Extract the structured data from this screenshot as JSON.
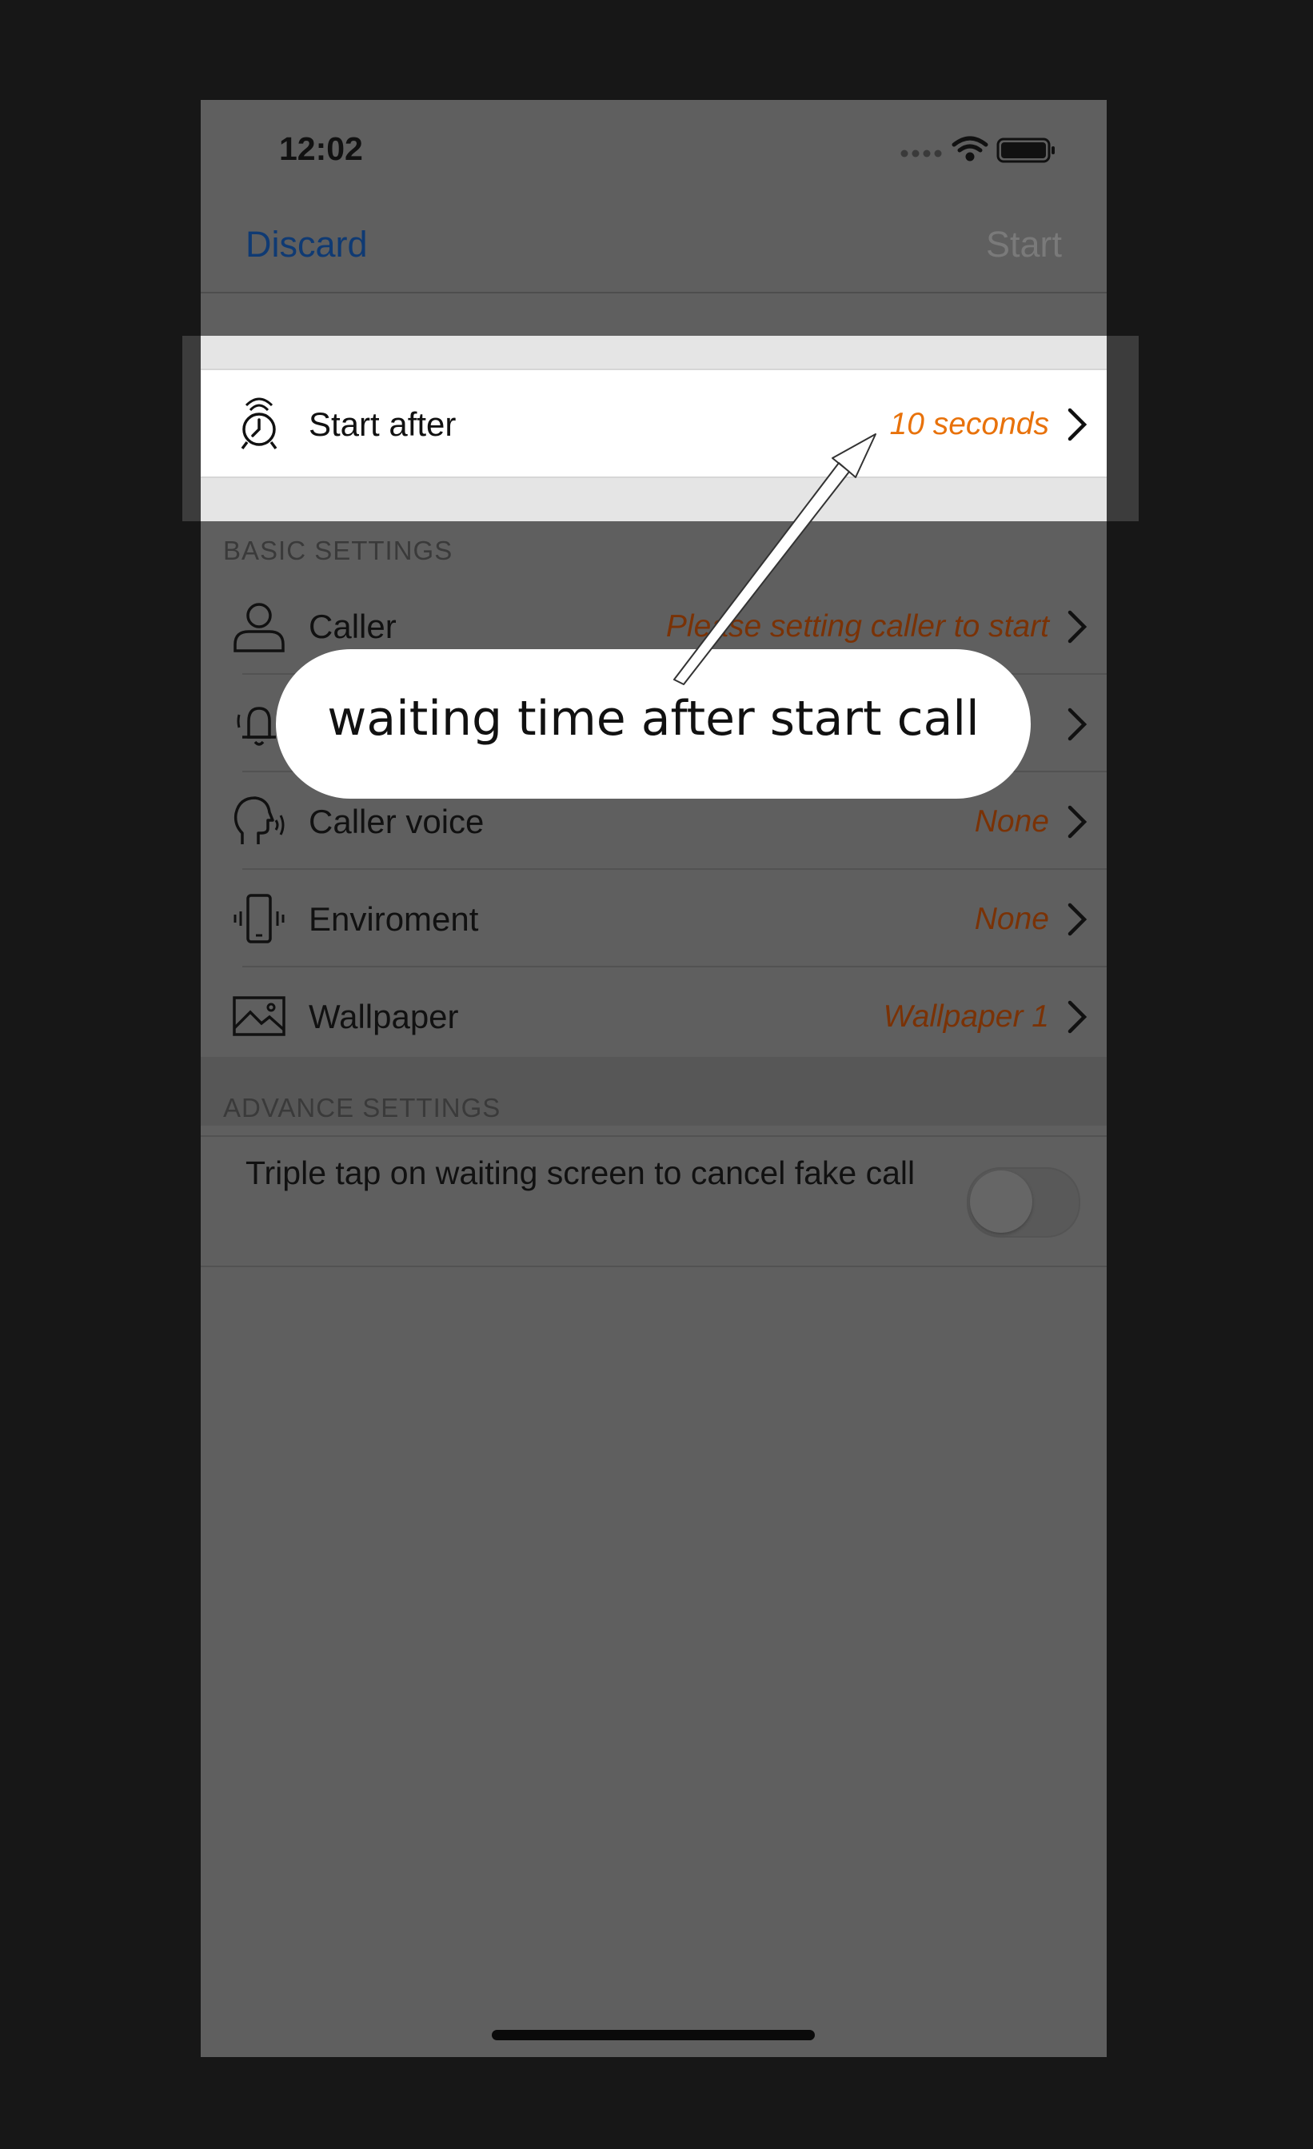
{
  "status_bar": {
    "time": "12:02"
  },
  "nav": {
    "discard_label": "Discard",
    "start_label": "Start"
  },
  "highlight_row": {
    "icon": "alarm-clock-icon",
    "label": "Start after",
    "value": "10 seconds"
  },
  "basic_settings": {
    "header": "BASIC SETTINGS",
    "items": [
      {
        "icon": "person-icon",
        "label": "Caller",
        "value": "Please setting caller to start"
      },
      {
        "icon": "ringing-bell-icon",
        "label": "",
        "value": ""
      },
      {
        "icon": "speaking-head-icon",
        "label": "Caller voice",
        "value": "None"
      },
      {
        "icon": "vibrating-phone-icon",
        "label": "Enviroment",
        "value": "None"
      },
      {
        "icon": "picture-icon",
        "label": "Wallpaper",
        "value": "Wallpaper 1"
      }
    ]
  },
  "advance_settings": {
    "header": "ADVANCE SETTINGS",
    "triple_tap_label": "Triple tap on waiting screen to cancel fake call",
    "triple_tap_enabled": false
  },
  "callout": {
    "text": "waiting time after start call"
  },
  "colors": {
    "value_highlight": "#e8720b",
    "value_dim": "#7a3206",
    "link": "#0f3a73",
    "background": "#171717"
  }
}
